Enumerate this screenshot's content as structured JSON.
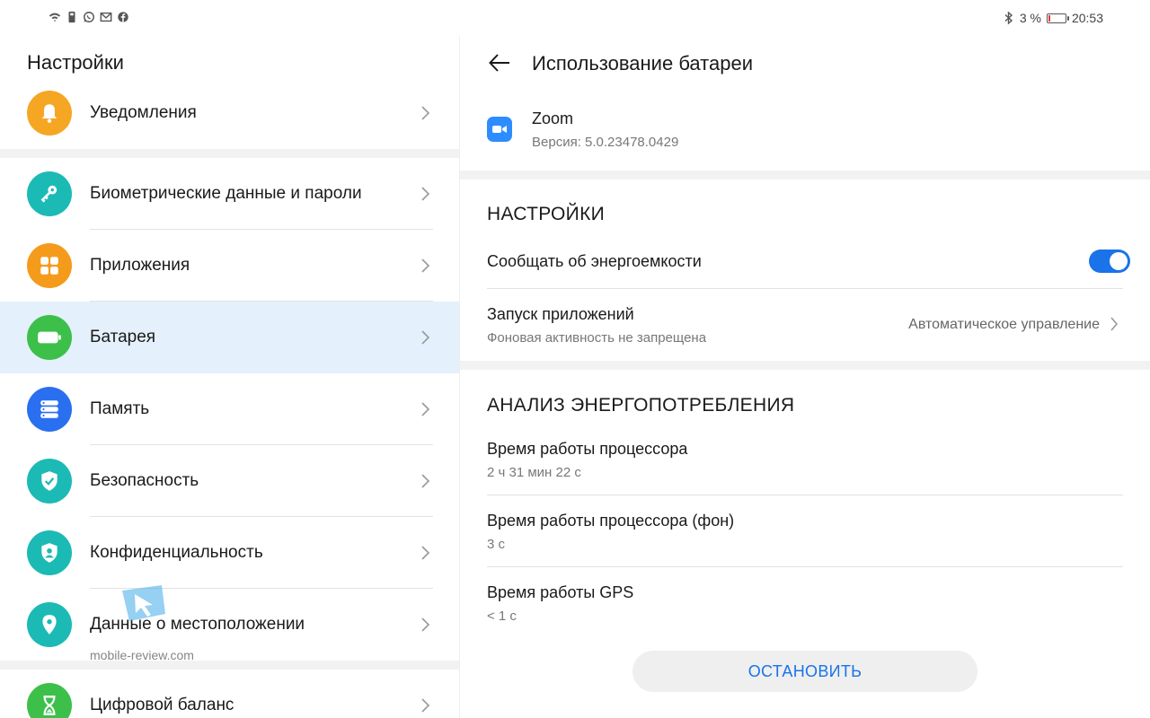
{
  "status_bar": {
    "left_icons": [
      "wifi-icon",
      "sim-icon",
      "whatsapp-icon",
      "mail-icon",
      "facebook-icon"
    ],
    "battery_percent": "3 %",
    "battery_level": 0.03,
    "time": "20:53"
  },
  "left_pane": {
    "title": "Настройки",
    "items": [
      {
        "label": "Уведомления",
        "icon": "bell-icon",
        "color": "#f5a623"
      },
      {
        "label": "Биометрические данные и пароли",
        "icon": "key-icon",
        "color": "#1cbab5"
      },
      {
        "label": "Приложения",
        "icon": "apps-grid-icon",
        "color": "#f59b1c"
      },
      {
        "label": "Батарея",
        "icon": "battery-icon",
        "color": "#3cc04a",
        "active": true
      },
      {
        "label": "Память",
        "icon": "storage-icon",
        "color": "#2a6ff0"
      },
      {
        "label": "Безопасность",
        "icon": "shield-check-icon",
        "color": "#1cbab5"
      },
      {
        "label": "Конфиденциальность",
        "icon": "privacy-icon",
        "color": "#1cbab5"
      },
      {
        "label": "Данные о местоположении",
        "icon": "location-pin-icon",
        "color": "#1cbab5"
      },
      {
        "label": "Цифровой баланс",
        "icon": "hourglass-icon",
        "color": "#3cc04a"
      }
    ]
  },
  "right_pane": {
    "title": "Использование батареи",
    "app": {
      "name": "Zoom",
      "version": "Версия: 5.0.23478.0429",
      "icon": "zoom-camera-icon",
      "color": "#2d8cff"
    },
    "settings_section": {
      "title": "НАСТРОЙКИ",
      "notify_label": "Сообщать об энергоемкости",
      "notify_enabled": true,
      "launch_label": "Запуск приложений",
      "launch_sub": "Фоновая активность не запрещена",
      "launch_value": "Автоматическое управление"
    },
    "analysis_section": {
      "title": "АНАЛИЗ ЭНЕРГОПОТРЕБЛЕНИЯ",
      "rows": [
        {
          "label": "Время работы процессора",
          "value": "2 ч 31 мин 22 с"
        },
        {
          "label": "Время работы процессора (фон)",
          "value": "3 с"
        },
        {
          "label": "Время работы GPS",
          "value": "< 1 с"
        }
      ]
    },
    "stop_button": "ОСТАНОВИТЬ"
  },
  "watermark": {
    "text": "mobile-review.com"
  },
  "colors": {
    "accent": "#1a73e8",
    "active_row": "#e4f0fb",
    "separator": "#f2f2f2"
  }
}
